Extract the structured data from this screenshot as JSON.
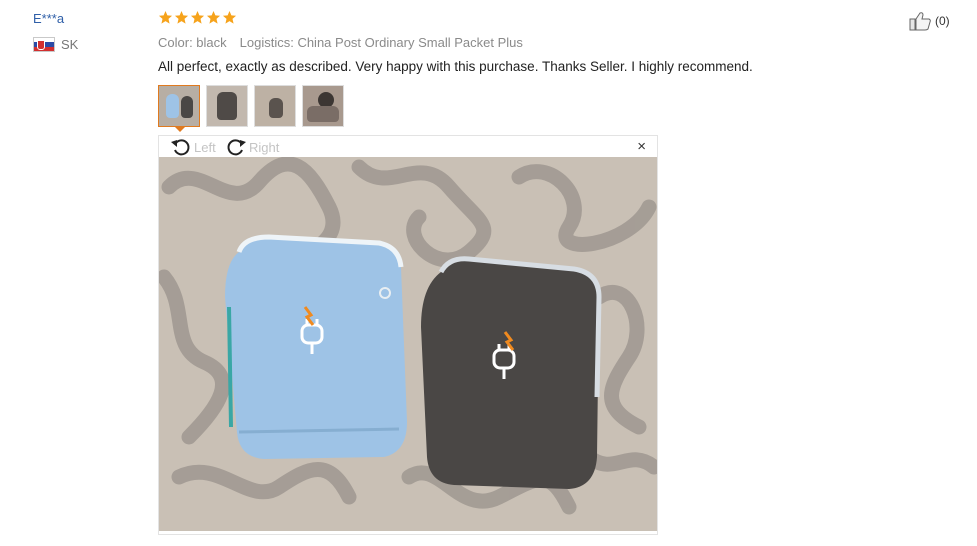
{
  "review": {
    "user_name": "E***a",
    "country": "SK",
    "rating": 5,
    "color_text": "Color: black",
    "logistics_text": "Logistics: China Post Ordinary Small Packet Plus",
    "text": "All perfect, exactly as described. Very happy with this purchase. Thanks Seller. I highly recommend.",
    "likes": "(0)"
  },
  "viewer": {
    "rotate_left_label": "Left",
    "rotate_right_label": "Right",
    "close_label": "×"
  },
  "icons": {
    "star": "star-icon",
    "flag": "flag-sk-icon",
    "rotate_left": "rotate-left-icon",
    "rotate_right": "rotate-right-icon",
    "close": "close-icon",
    "thumbs_up": "thumbs-up-icon"
  },
  "colors": {
    "star": "#f6a31c",
    "user_link": "#2f5fa8",
    "active_thumb": "#e07a1f",
    "bag_blue": "#9ec3e6",
    "bag_black": "#4a4745"
  }
}
